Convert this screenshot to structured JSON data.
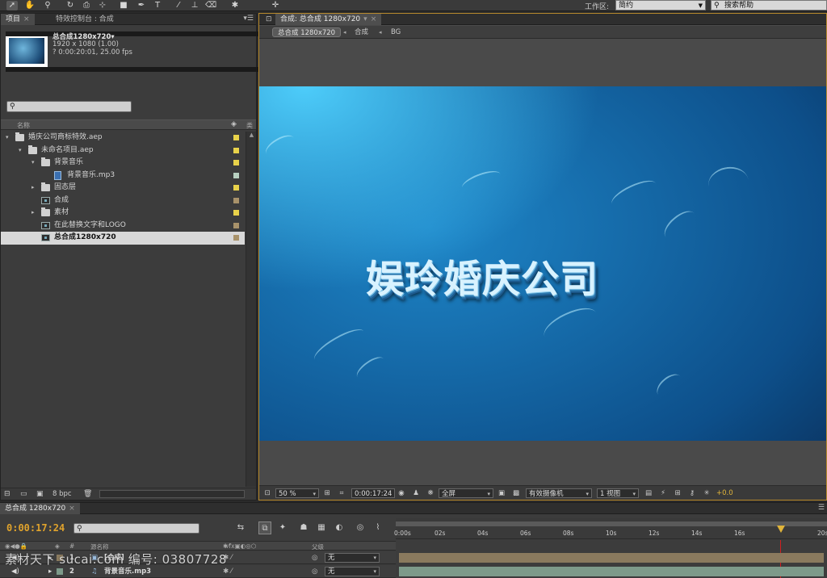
{
  "toolbar": {
    "workspace_label": "工作区:",
    "workspace_value": "简约",
    "help_search": "搜索帮助"
  },
  "project_panel": {
    "tabs": [
      {
        "label": "项目"
      },
      {
        "label": "特效控制台 : 合成"
      }
    ],
    "selected": {
      "name": "总合成1280x720▾",
      "size": "1920 x 1080 (1.00)",
      "duration": "? 0:00:20:01, 25.00 fps"
    },
    "search_placeholder": "",
    "columns": {
      "name": "名称",
      "type": "类"
    },
    "items": [
      {
        "label": "婚庆公司商标特效.aep",
        "icon": "folder-icon",
        "level": 0,
        "twirl": "▾",
        "swatch": "#e8d24a"
      },
      {
        "label": "未命名项目.aep",
        "icon": "folder-icon",
        "level": 1,
        "twirl": "▾",
        "swatch": "#e8d24a"
      },
      {
        "label": "背景音乐",
        "icon": "folder-icon",
        "level": 2,
        "twirl": "▾",
        "swatch": "#e8d24a"
      },
      {
        "label": "背景音乐.mp3",
        "icon": "audio-file-icon",
        "level": 3,
        "twirl": "",
        "swatch": "#b8d0c0"
      },
      {
        "label": "固态层",
        "icon": "folder-icon",
        "level": 2,
        "twirl": "▸",
        "swatch": "#e8d24a"
      },
      {
        "label": "合成",
        "icon": "composition-icon",
        "level": 2,
        "twirl": "",
        "swatch": "#a8926a"
      },
      {
        "label": "素材",
        "icon": "folder-icon",
        "level": 2,
        "twirl": "▸",
        "swatch": "#e8d24a"
      },
      {
        "label": "在此替换文字和LOGO",
        "icon": "composition-icon",
        "level": 2,
        "twirl": "",
        "swatch": "#a8926a"
      },
      {
        "label": "总合成1280x720",
        "icon": "composition-icon",
        "level": 2,
        "twirl": "",
        "swatch": "#a8926a",
        "selected": true
      }
    ],
    "footer": {
      "bpc": "8 bpc"
    }
  },
  "composition_panel": {
    "tab_label": "合成: 总合成 1280x720",
    "breadcrumbs": [
      "总合成 1280x720",
      "合成",
      "BG"
    ],
    "brand_text": "娱玲婚庆公司",
    "controls": {
      "zoom": "50 %",
      "timecode": "0:00:17:24",
      "resolution": "全屏",
      "camera": "有效摄像机",
      "views": "1 视图",
      "exposure": "+0.0"
    }
  },
  "timeline_panel": {
    "tab_label": "总合成 1280x720",
    "timecode": "0:00:17:24",
    "ruler_ticks": [
      "0:00s",
      "02s",
      "04s",
      "06s",
      "08s",
      "10s",
      "12s",
      "14s",
      "16s",
      "20s"
    ],
    "playhead_seconds": 17.96,
    "columns": {
      "source": "源名称",
      "parent": "父级"
    },
    "layers": [
      {
        "index": "1",
        "name": "[合成]",
        "parent": "无",
        "bar_color": "#8a7a5e"
      },
      {
        "index": "2",
        "name": "背景音乐.mp3",
        "parent": "无",
        "bar_color": "#7d9a8a"
      }
    ]
  },
  "watermark": "素材天下 sucai.com   编号: 03807728"
}
